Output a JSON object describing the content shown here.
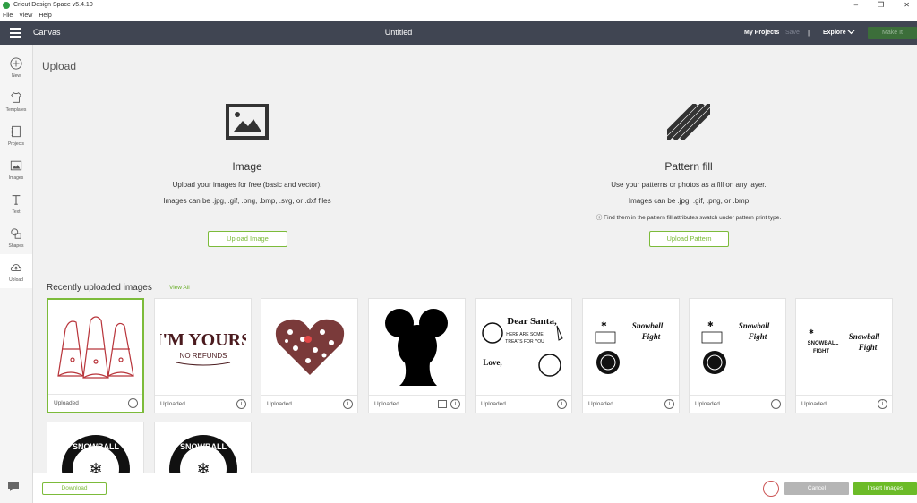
{
  "window": {
    "title": "Cricut Design Space  v5.4.10",
    "menu": [
      "File",
      "View",
      "Help"
    ],
    "controls": [
      "–",
      "❐",
      "✕"
    ]
  },
  "header": {
    "canvas_label": "Canvas",
    "doc_title": "Untitled",
    "my_projects": "My Projects",
    "save": "Save",
    "separator": "|",
    "explore": "Explore",
    "make_it": "Make It"
  },
  "sidebar": {
    "items": [
      {
        "label": "New",
        "icon": "plus-icon"
      },
      {
        "label": "Templates",
        "icon": "shirt-icon"
      },
      {
        "label": "Projects",
        "icon": "notebook-icon"
      },
      {
        "label": "Images",
        "icon": "image-icon"
      },
      {
        "label": "Text",
        "icon": "text-icon"
      },
      {
        "label": "Shapes",
        "icon": "shapes-icon"
      },
      {
        "label": "Upload",
        "icon": "cloud-upload-icon"
      }
    ]
  },
  "main": {
    "page_title": "Upload",
    "image_upload": {
      "title": "Image",
      "line1": "Upload your images for free (basic and vector).",
      "line2": "Images can be .jpg, .gif, .png, .bmp, .svg, or .dxf files",
      "button": "Upload Image"
    },
    "pattern_upload": {
      "title": "Pattern fill",
      "line1": "Use your patterns or photos as a fill on any layer.",
      "line2": "Images can be .jpg, .gif, .png, or .bmp",
      "info": "Find them in the pattern fill attributes swatch under pattern print type.",
      "button": "Upload Pattern"
    },
    "recent_title": "Recently uploaded images",
    "view_all": "View All",
    "thumbnails": [
      {
        "caption": "Uploaded",
        "art": "gnomes"
      },
      {
        "caption": "Uploaded",
        "art": "im-yours",
        "text1": "I'M YOURS",
        "text2": "NO REFUNDS"
      },
      {
        "caption": "Uploaded",
        "art": "leopard-heart"
      },
      {
        "caption": "Uploaded",
        "art": "afro-silhouette"
      },
      {
        "caption": "Uploaded",
        "art": "dear-santa",
        "text1": "Dear Santa,",
        "text2": "HERE ARE SOME",
        "text3": "TREATS FOR YOU",
        "text4": "Love,"
      },
      {
        "caption": "Uploaded",
        "art": "snowball-fight",
        "text1": "Snowball",
        "text2": "Fight"
      },
      {
        "caption": "Uploaded",
        "art": "snowball-fight",
        "text1": "Snowball",
        "text2": "Fight"
      },
      {
        "caption": "Uploaded",
        "art": "snowball-fight-text",
        "text1": "SNOWBALL",
        "text2": "FIGHT",
        "text3": "Snowball",
        "text4": "Fight"
      },
      {
        "caption": "",
        "art": "snowball-badge",
        "text1": "SNOWBALL"
      },
      {
        "caption": "",
        "art": "snowball-badge",
        "text1": "SNOWBALL"
      }
    ]
  },
  "footer": {
    "download": "Download",
    "cancel": "Cancel",
    "insert": "Insert Images"
  },
  "colors": {
    "accent_green": "#6cbb28",
    "header_bg": "#404552",
    "gnome_red": "#b8343a"
  }
}
